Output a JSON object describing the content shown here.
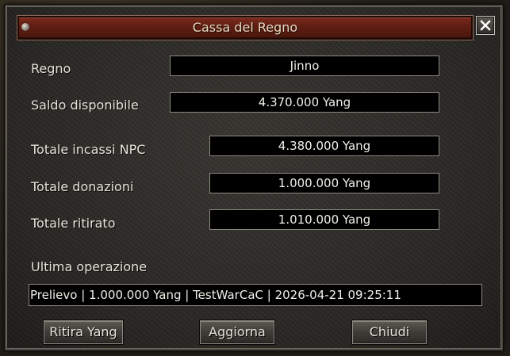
{
  "window": {
    "title": "Cassa del Regno",
    "close_icon": "close-icon"
  },
  "fields": {
    "regno": {
      "label": "Regno",
      "value": "Jinno"
    },
    "saldo": {
      "label": "Saldo disponibile",
      "value": "4.370.000 Yang"
    },
    "incassi": {
      "label": "Totale incassi NPC",
      "value": "4.380.000 Yang"
    },
    "donazioni": {
      "label": "Totale donazioni",
      "value": "1.000.000 Yang"
    },
    "ritirato": {
      "label": "Totale ritirato",
      "value": "1.010.000 Yang"
    }
  },
  "last_operation": {
    "label": "Ultima operazione",
    "value": "Prelievo | 1.000.000 Yang | TestWarCaC | 2026-04-21 09:25:11"
  },
  "buttons": {
    "withdraw": "Ritira Yang",
    "refresh": "Aggiorna",
    "close": "Chiudi"
  },
  "colors": {
    "title_bar": "#5e1e12",
    "field_bg": "#000000",
    "text": "#e6e2da"
  }
}
